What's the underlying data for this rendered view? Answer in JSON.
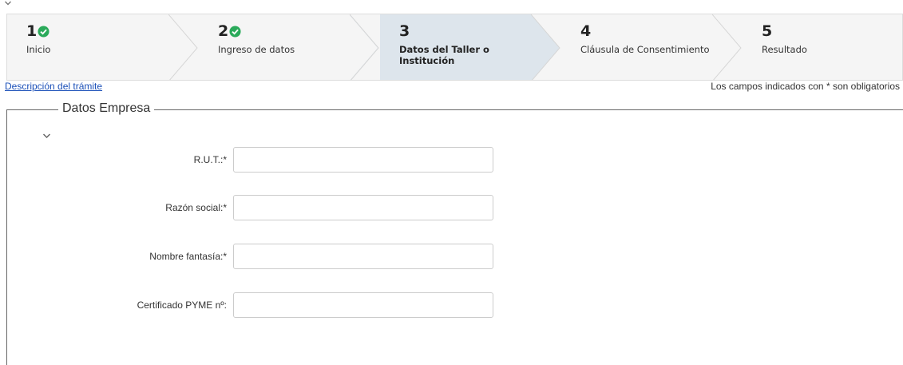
{
  "wizard": {
    "steps": [
      {
        "number": "1",
        "label": "Inicio",
        "completed": true,
        "active": false
      },
      {
        "number": "2",
        "label": "Ingreso de datos",
        "completed": true,
        "active": false
      },
      {
        "number": "3",
        "label": "Datos del Taller o\nInstitución",
        "completed": false,
        "active": true
      },
      {
        "number": "4",
        "label": "Cláusula de Consentimiento",
        "completed": false,
        "active": false
      },
      {
        "number": "5",
        "label": "Resultado",
        "completed": false,
        "active": false
      }
    ]
  },
  "links": {
    "description": "Descripción del trámite"
  },
  "notes": {
    "required": "Los campos indicados con * son obligatorios"
  },
  "section": {
    "title": "Datos Empresa",
    "fields": [
      {
        "label": "R.U.T.:*",
        "value": "",
        "placeholder": ""
      },
      {
        "label": "Razón social:*",
        "value": "",
        "placeholder": ""
      },
      {
        "label": "Nombre fantasía:*",
        "value": "",
        "placeholder": ""
      },
      {
        "label": "Certificado PYME nº:",
        "value": "",
        "placeholder": ""
      }
    ]
  },
  "colors": {
    "check_green": "#2aaa5a",
    "active_step_bg": "#dde5ec",
    "link": "#1a4fb8"
  },
  "icons": {
    "collapse": "chevron-down-icon",
    "completed": "check-circle-icon"
  }
}
